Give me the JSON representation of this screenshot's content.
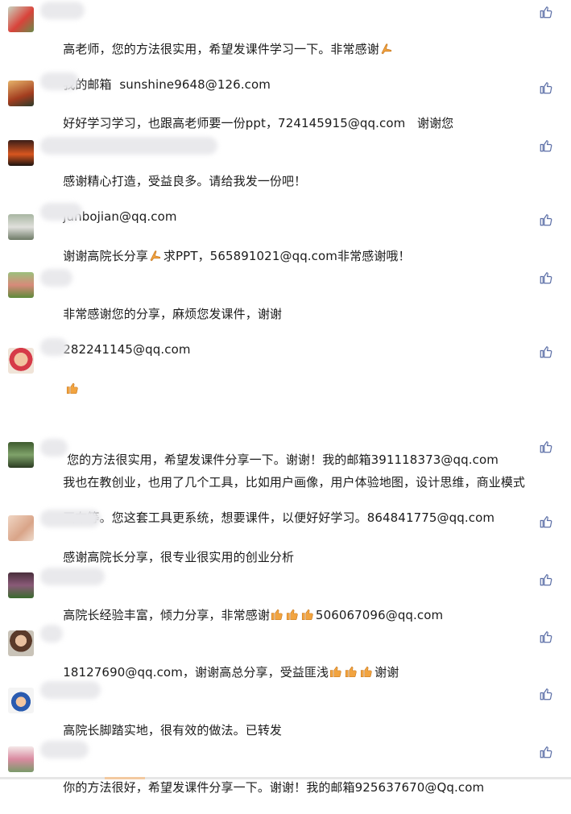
{
  "comments": [
    {
      "text": "高老师，您的方法很实用，希望发课件学习一下。非常感谢",
      "emoji_after": "pray",
      "line2": "我的邮箱  sunshine9648@126.com"
    },
    {
      "text": "好好学习学习，也跟高老师要一份ppt，724145915@qq.com   谢谢您"
    },
    {
      "text": "感谢精心打造，受益良多。请给我发一份吧！",
      "line2": "junbojian@qq.com"
    },
    {
      "text_a": "谢谢高院长分享",
      "emoji_mid": "pray",
      "text_b": "求PPT，565891021@qq.com非常感谢哦！"
    },
    {
      "text": "非常感谢您的分享，麻烦您发课件，谢谢",
      "line2": "282241145@qq.com"
    },
    {
      "emoji_line": "thumbs-up",
      "text": " 您的方法很实用，希望发课件分享一下。谢谢！我的邮箱391118373@qq.com"
    },
    {
      "text": "我也在教创业，也用了几个工具，比如用户画像，用户体验地图，设计思维，商业模式",
      "line2": "画布等。您这套工具更系统，想要课件，以便好好学习。864841775@qq.com"
    },
    {
      "text": "感谢高院长分享，很专业很实用的创业分析"
    },
    {
      "text_a": "高院长经验丰富，倾力分享，非常感谢",
      "emojis": [
        "thumbs-up",
        "thumbs-up",
        "thumbs-up"
      ],
      "text_b": "506067096@qq.com"
    },
    {
      "text_a": "18127690@qq.com，谢谢高总分享，受益匪浅",
      "emojis": [
        "thumbs-up",
        "thumbs-up",
        "thumbs-up"
      ],
      "text_b": "谢谢"
    },
    {
      "text": "高院长脚踏实地，很有效的做法。已转发"
    },
    {
      "text": "你的方法很好，希望发课件分享一下。谢谢！我的邮箱925637670@Qq.com"
    }
  ],
  "icons": {
    "like": "thumbs-up-outline-icon"
  },
  "colors": {
    "like": "#5b6ea6",
    "emoji": "#f2a440",
    "blur": "#e9e9ec"
  }
}
